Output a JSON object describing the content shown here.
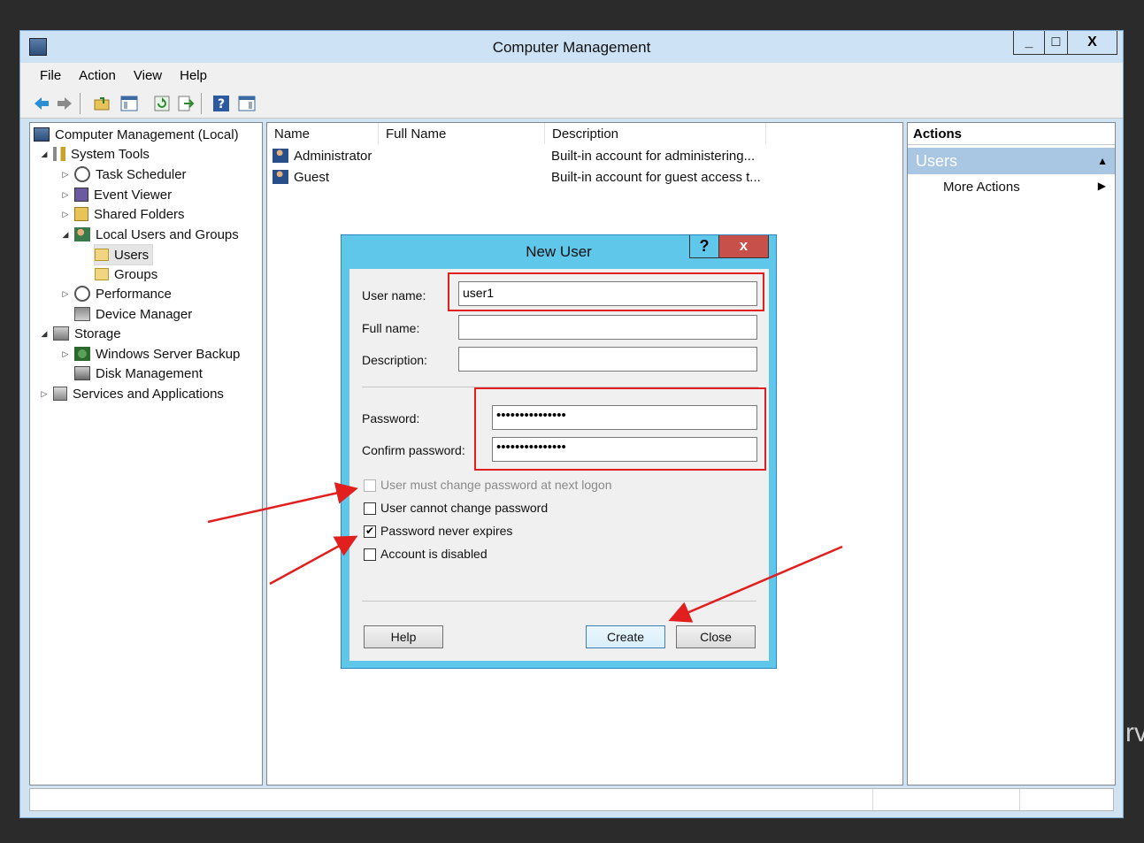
{
  "window": {
    "title": "Computer Management",
    "buttons": {
      "minimize": "_",
      "maximize": "□",
      "close": "X"
    }
  },
  "menu": [
    "File",
    "Action",
    "View",
    "Help"
  ],
  "tree": {
    "root": "Computer Management (Local)",
    "system_tools": "System Tools",
    "task_scheduler": "Task Scheduler",
    "event_viewer": "Event Viewer",
    "shared_folders": "Shared Folders",
    "local_users_groups": "Local Users and Groups",
    "users": "Users",
    "groups": "Groups",
    "performance": "Performance",
    "device_manager": "Device Manager",
    "storage": "Storage",
    "windows_server_backup": "Windows Server Backup",
    "disk_management": "Disk Management",
    "services_apps": "Services and Applications"
  },
  "list": {
    "columns": [
      "Name",
      "Full Name",
      "Description"
    ],
    "rows": [
      {
        "name": "Administrator",
        "full_name": "",
        "description": "Built-in account for administering..."
      },
      {
        "name": "Guest",
        "full_name": "",
        "description": "Built-in account for guest access t..."
      }
    ]
  },
  "actions": {
    "header": "Actions",
    "section": "Users",
    "more_actions": "More Actions"
  },
  "dialog": {
    "title": "New User",
    "help_glyph": "?",
    "close_glyph": "x",
    "labels": {
      "user_name": "User name:",
      "full_name": "Full name:",
      "description": "Description:",
      "password": "Password:",
      "confirm_password": "Confirm password:"
    },
    "values": {
      "user_name": "user1",
      "full_name": "",
      "description": "",
      "password": "•••••••••••••••",
      "confirm_password": "•••••••••••••••"
    },
    "checkboxes": [
      {
        "label": "User must change password at next logon",
        "checked": false,
        "disabled": true
      },
      {
        "label": "User cannot change password",
        "checked": false,
        "disabled": false
      },
      {
        "label": "Password never expires",
        "checked": true,
        "disabled": false
      },
      {
        "label": "Account is disabled",
        "checked": false,
        "disabled": false
      }
    ],
    "buttons": {
      "help": "Help",
      "create": "Create",
      "close": "Close"
    }
  },
  "background_text": "rv",
  "colors": {
    "highlight_red": "#e21f1f",
    "dialog_frame": "#5ec7ea",
    "window_frame": "#cde2f4"
  }
}
